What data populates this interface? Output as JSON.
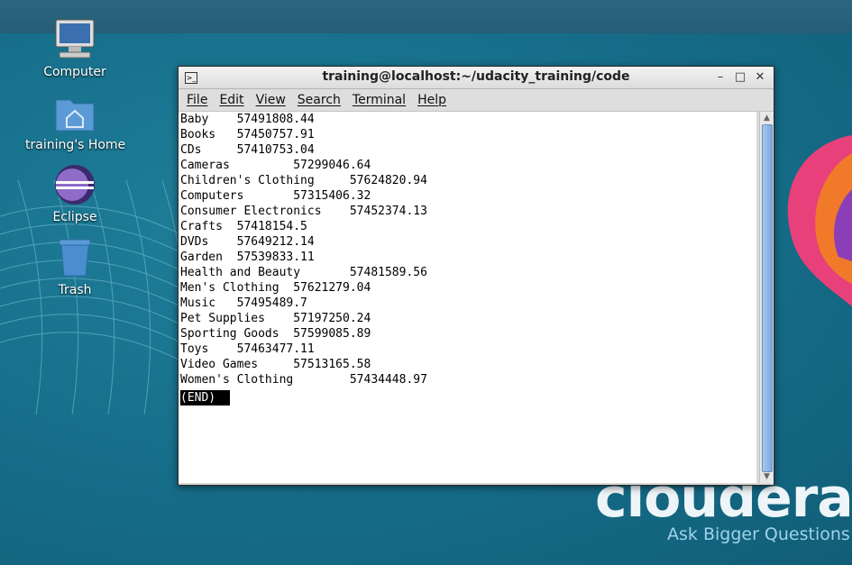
{
  "desktop": {
    "icons": [
      {
        "label": "Computer",
        "icon": "computer-icon"
      },
      {
        "label": "training's Home",
        "icon": "home-folder-icon"
      },
      {
        "label": "Eclipse",
        "icon": "eclipse-icon"
      },
      {
        "label": "Trash",
        "icon": "trash-icon"
      }
    ],
    "brand": {
      "word": "cloudera",
      "tagline": "Ask Bigger Questions"
    }
  },
  "window": {
    "title": "training@localhost:~/udacity_training/code",
    "controls": {
      "minimize": "–",
      "maximize": "□",
      "close": "✕"
    },
    "menu": [
      "File",
      "Edit",
      "View",
      "Search",
      "Terminal",
      "Help"
    ]
  },
  "terminal": {
    "lines": [
      "Baby\t57491808.44",
      "Books\t57450757.91",
      "CDs\t57410753.04",
      "Cameras\t\t57299046.64",
      "Children's Clothing\t57624820.94",
      "Computers\t57315406.32",
      "Consumer Electronics\t57452374.13",
      "Crafts\t57418154.5",
      "DVDs\t57649212.14",
      "Garden\t57539833.11",
      "Health and Beauty\t57481589.56",
      "Men's Clothing\t57621279.04",
      "Music\t57495489.7",
      "Pet Supplies\t57197250.24",
      "Sporting Goods\t57599085.89",
      "Toys\t57463477.11",
      "Video Games\t57513165.58",
      "Women's Clothing\t57434448.97"
    ],
    "pager_end": "(END)"
  }
}
